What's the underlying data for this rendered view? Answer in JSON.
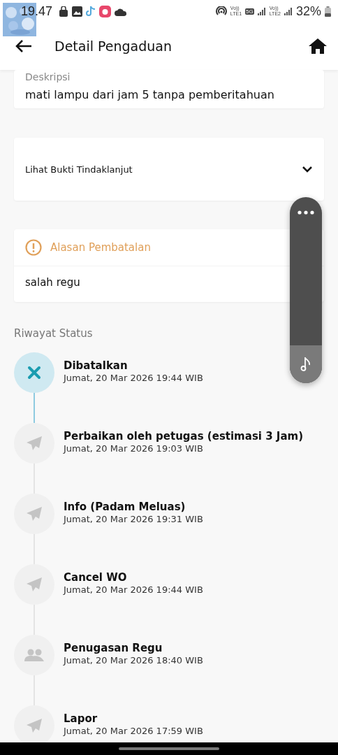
{
  "status_bar": {
    "time": "19.47",
    "network_labels": [
      "Vo))",
      "LTE1",
      "5G",
      "Vo))",
      "LTE2"
    ],
    "battery": "32%"
  },
  "app_bar": {
    "title": "Detail Pengaduan"
  },
  "description": {
    "label": "Deskripsi",
    "value": "mati lampu dari jam 5 tanpa pemberitahuan"
  },
  "evidence": {
    "label": "Lihat Bukti Tindaklanjut",
    "expanded": false
  },
  "cancellation": {
    "title": "Alasan Pembatalan",
    "reason": "salah regu"
  },
  "history": {
    "title": "Riwayat Status",
    "items": [
      {
        "kind": "cancel",
        "title": "Dibatalkan",
        "time": "Jumat, 20 Mar 2026 19:44 WIB"
      },
      {
        "kind": "plane",
        "title": "Perbaikan oleh petugas (estimasi 3 Jam)",
        "time": "Jumat, 20 Mar 2026 19:03 WIB"
      },
      {
        "kind": "plane",
        "title": "Info (Padam Meluas)",
        "time": "Jumat, 20 Mar 2026 19:31 WIB"
      },
      {
        "kind": "plane",
        "title": "Cancel WO",
        "time": "Jumat, 20 Mar 2026 19:44 WIB"
      },
      {
        "kind": "people",
        "title": "Penugasan Regu",
        "time": "Jumat, 20 Mar 2026 18:40 WIB"
      },
      {
        "kind": "plane",
        "title": "Lapor",
        "time": "Jumat, 20 Mar 2026 17:59 WIB"
      }
    ]
  }
}
